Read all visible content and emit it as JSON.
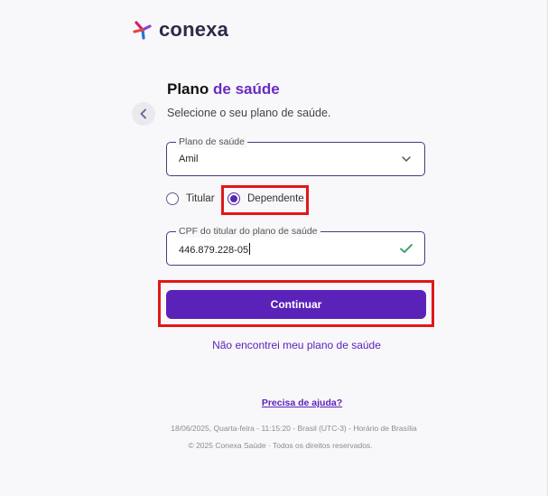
{
  "brand": {
    "name": "conexa",
    "colors": {
      "primary": "#5b22ba",
      "accent": "#6b2bc0",
      "highlight": "#e01818"
    }
  },
  "header": {
    "back_icon": "chevron-left-icon"
  },
  "page": {
    "title_main": "Plano ",
    "title_accent": "de saúde",
    "subtitle": "Selecione o seu plano de saúde."
  },
  "plan_field": {
    "label": "Plano de saúde",
    "value": "Amil",
    "icon": "chevron-down-icon"
  },
  "holder_type": {
    "options": [
      {
        "label": "Titular",
        "selected": false
      },
      {
        "label": "Dependente",
        "selected": true
      }
    ]
  },
  "cpf_field": {
    "label": "CPF do titular do plano de saúde",
    "value": "446.879.228-05",
    "valid_icon": "check-icon"
  },
  "continue_label": "Continuar",
  "not_found_link": "Não encontrei meu plano de saúde",
  "help_link": "Precisa de ajuda?",
  "footer": {
    "datetime": "18/06/2025, Quarta-feira - 11:15:20 - Brasil (UTC-3) - Horário de Brasília",
    "copyright": "© 2025 Conexa Saúde · Todos os direitos reservados."
  }
}
